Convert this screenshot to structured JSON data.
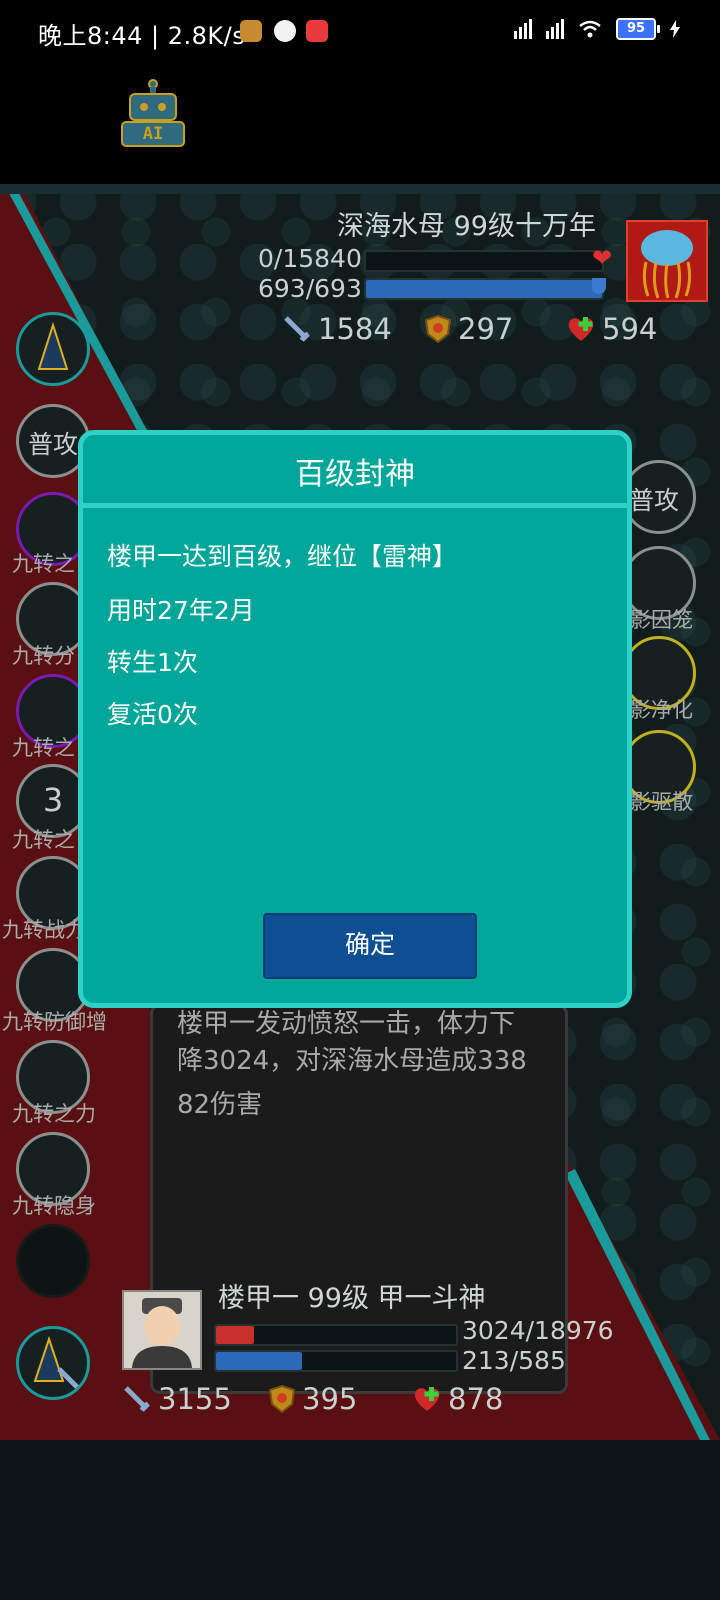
{
  "status_bar": {
    "time_and_speed": "晚上8:44 | 2.8K/s",
    "battery": "95"
  },
  "ai_button": {
    "label": "AI"
  },
  "enemy": {
    "name": "深海水母 99级十万年",
    "hp_text": "0/15840",
    "hp_fraction": 0,
    "mp_text": "693/693",
    "mp_fraction": 1,
    "attack": "1584",
    "defense": "297",
    "heal": "594"
  },
  "left_skills": [
    {
      "label": ""
    },
    {
      "label": "普攻"
    },
    {
      "label": "九转之"
    },
    {
      "label": "九转分"
    },
    {
      "label": "九转之"
    },
    {
      "label": "九转之",
      "badge": "3"
    },
    {
      "label": "九转战力"
    },
    {
      "label": "九转防御增"
    },
    {
      "label": "九转之力"
    },
    {
      "label": "九转隐身"
    }
  ],
  "right_skills": [
    {
      "label": "普攻"
    },
    {
      "label": "影囚笼"
    },
    {
      "label": "影净化"
    },
    {
      "label": "影驱散"
    }
  ],
  "battle_log": {
    "partial_top": "楼甲一发动愤怒一击，体力下",
    "text": "降3024，对深海水母造成33882伤害"
  },
  "player": {
    "name": "楼甲一 99级 甲一斗神",
    "hp_text": "3024/18976",
    "hp_fraction": 0.16,
    "mp_text": "213/585",
    "mp_fraction": 0.36,
    "attack": "3155",
    "defense": "395",
    "heal": "878"
  },
  "modal": {
    "title": "百级封神",
    "lines": [
      "楼甲一达到百级，继位【雷神】",
      "用时27年2月",
      "转生1次",
      "复活0次"
    ],
    "confirm": "确定"
  }
}
